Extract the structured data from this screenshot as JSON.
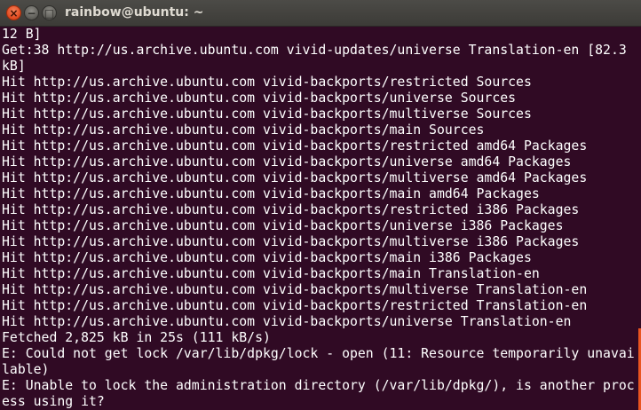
{
  "window": {
    "title": "rainbow@ubuntu: ~",
    "buttons": {
      "close_glyph": "×",
      "minimize_glyph": "−",
      "maximize_glyph": "□"
    }
  },
  "colors": {
    "terminal_background": "#300a24",
    "text": "#ffffff",
    "close_button": "#e0491f",
    "accent": "#e95420"
  },
  "terminal": {
    "lines": [
      "12 B]",
      "Get:38 http://us.archive.ubuntu.com vivid-updates/universe Translation-en [82.3",
      "kB]",
      "Hit http://us.archive.ubuntu.com vivid-backports/restricted Sources",
      "Hit http://us.archive.ubuntu.com vivid-backports/universe Sources",
      "Hit http://us.archive.ubuntu.com vivid-backports/multiverse Sources",
      "Hit http://us.archive.ubuntu.com vivid-backports/main Sources",
      "Hit http://us.archive.ubuntu.com vivid-backports/restricted amd64 Packages",
      "Hit http://us.archive.ubuntu.com vivid-backports/universe amd64 Packages",
      "Hit http://us.archive.ubuntu.com vivid-backports/multiverse amd64 Packages",
      "Hit http://us.archive.ubuntu.com vivid-backports/main amd64 Packages",
      "Hit http://us.archive.ubuntu.com vivid-backports/restricted i386 Packages",
      "Hit http://us.archive.ubuntu.com vivid-backports/universe i386 Packages",
      "Hit http://us.archive.ubuntu.com vivid-backports/multiverse i386 Packages",
      "Hit http://us.archive.ubuntu.com vivid-backports/main i386 Packages",
      "Hit http://us.archive.ubuntu.com vivid-backports/main Translation-en",
      "Hit http://us.archive.ubuntu.com vivid-backports/multiverse Translation-en",
      "Hit http://us.archive.ubuntu.com vivid-backports/restricted Translation-en",
      "Hit http://us.archive.ubuntu.com vivid-backports/universe Translation-en",
      "Fetched 2,825 kB in 25s (111 kB/s)",
      "E: Could not get lock /var/lib/dpkg/lock - open (11: Resource temporarily unavai",
      "lable)",
      "E: Unable to lock the administration directory (/var/lib/dpkg/), is another proc",
      "ess using it?"
    ]
  }
}
